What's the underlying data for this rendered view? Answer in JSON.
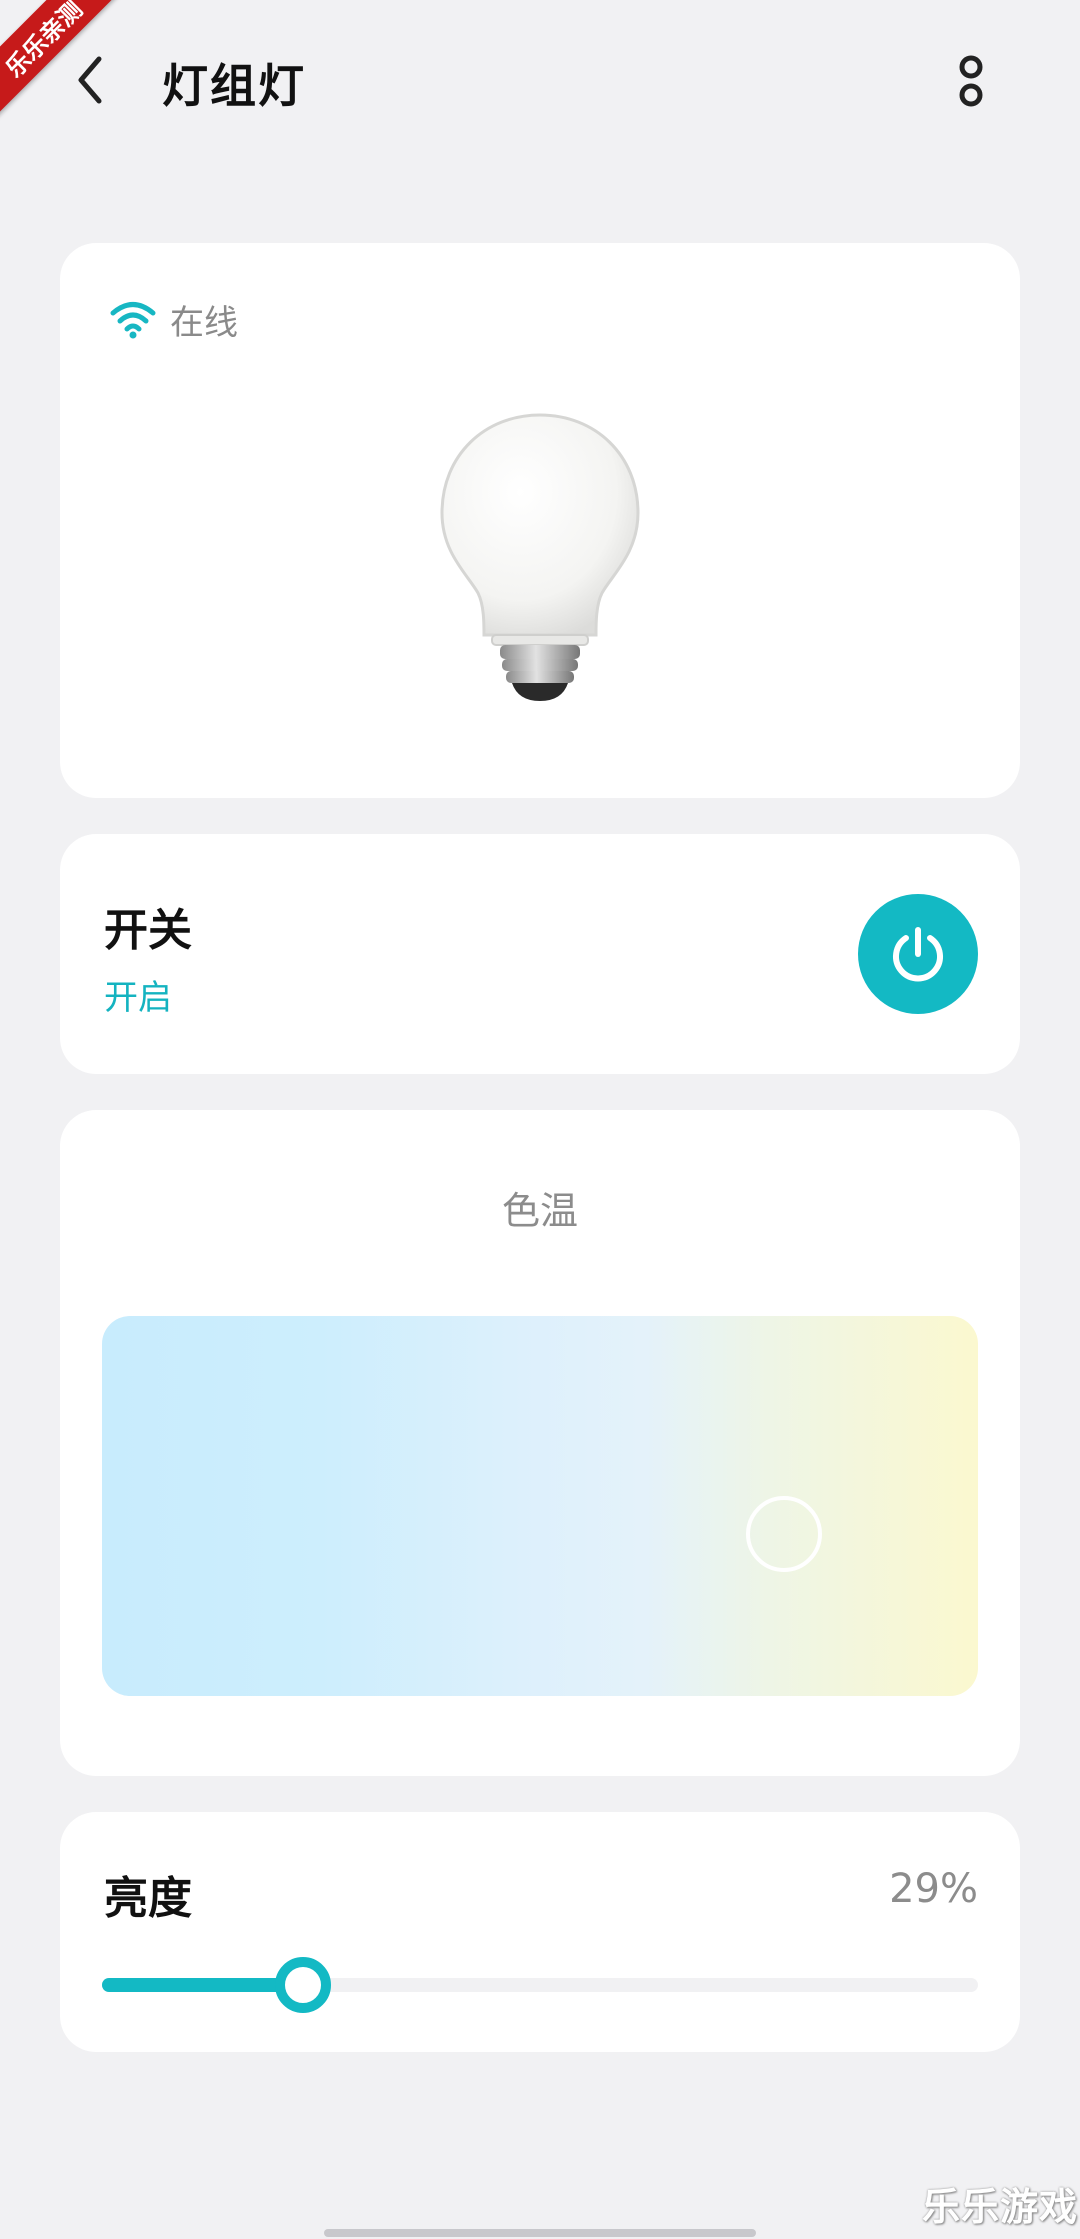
{
  "badge": {
    "text": "乐乐亲测"
  },
  "header": {
    "title": "灯组灯"
  },
  "device": {
    "status": "在线"
  },
  "switch": {
    "title": "开关",
    "state": "开启"
  },
  "color_temperature": {
    "title": "色温"
  },
  "brightness": {
    "title": "亮度",
    "value_text": "29%",
    "level_fraction": 0.23
  },
  "watermark": {
    "text": "乐乐游戏"
  },
  "colors": {
    "accent": "#13b9c4",
    "background": "#f1f1f3",
    "card": "#ffffff"
  }
}
